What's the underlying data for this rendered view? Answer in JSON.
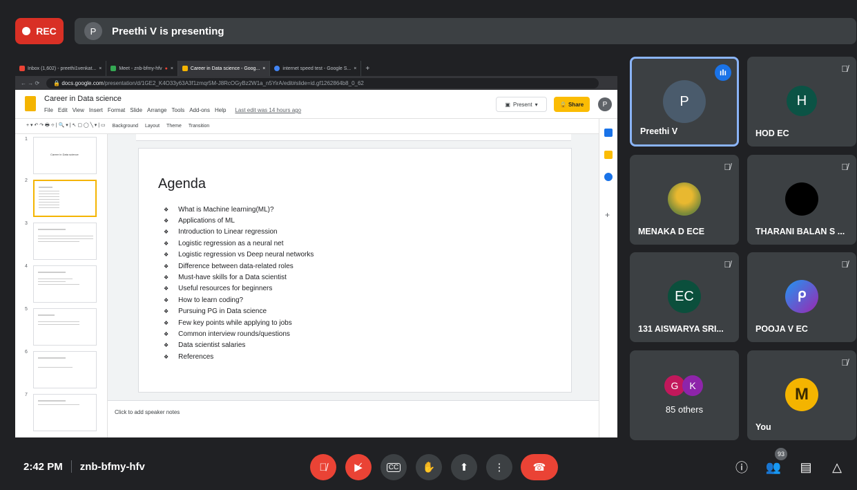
{
  "rec": {
    "label": "REC"
  },
  "presenter": {
    "initial": "P",
    "text": "Preethi V is presenting"
  },
  "browser": {
    "tabs": [
      {
        "label": "Inbox (1,602) - preethi1venkat...",
        "color": "#ea4335"
      },
      {
        "label": "Meet - znb-bfmy-hfv",
        "color": "#34a853"
      },
      {
        "label": "Career in Data science - Goog...",
        "color": "#f4b400"
      },
      {
        "label": "internet speed test - Google S...",
        "color": "#4285f4"
      }
    ],
    "url_domain": "docs.google.com",
    "url_path": "/presentation/d/1GE2_K4O33y63A3f1zmqr5M-J8RcOGyBz2W1a_n5YirA/edit#slide=id.gf1262864b8_0_62"
  },
  "slides_app": {
    "title": "Career in Data science",
    "menu": [
      "File",
      "Edit",
      "View",
      "Insert",
      "Format",
      "Slide",
      "Arrange",
      "Tools",
      "Add-ons",
      "Help"
    ],
    "last_edit": "Last edit was 14 hours ago",
    "present_label": "Present",
    "share_label": "Share",
    "user_initial": "P",
    "toolbar": [
      "Background",
      "Layout",
      "Theme",
      "Transition"
    ],
    "thumb_title": "Career in Data science",
    "thumb_numbers": [
      "1",
      "2",
      "3",
      "4",
      "5",
      "6",
      "7"
    ],
    "speaker_notes": "Click to add speaker notes",
    "slide": {
      "title": "Agenda",
      "items": [
        "What is Machine learning(ML)?",
        "Applications of ML",
        "Introduction to Linear regression",
        "Logistic regression as a neural net",
        "Logistic regression vs Deep neural networks",
        "Difference between data-related roles",
        "Must-have skills for a Data scientist",
        "Useful resources for beginners",
        "How to learn coding?",
        "Pursuing PG in Data science",
        "Few key points while applying to jobs",
        "Common interview rounds/questions",
        "Data scientist salaries",
        "References"
      ]
    }
  },
  "participants": [
    {
      "name": "Preethi V",
      "initial": "P",
      "color": "#4a5b6c",
      "speaking": true
    },
    {
      "name": "HOD EC",
      "initial": "H",
      "color": "#0b5345"
    },
    {
      "name": "MENAKA D ECE",
      "initial": "",
      "color": "#c9a227"
    },
    {
      "name": "THARANI BALAN S ...",
      "initial": "",
      "color": "#000000"
    },
    {
      "name": "131 AISWARYA SRI...",
      "initial": "EC",
      "color": "#0b4f3c"
    },
    {
      "name": "POOJA V EC",
      "initial": "",
      "color": "#7b2ff7"
    },
    {
      "name": "85 others",
      "initial": "",
      "color": ""
    },
    {
      "name": "You",
      "initial": "",
      "color": "#f4b400"
    }
  ],
  "others": {
    "a": "G",
    "b": "K",
    "a_color": "#c2185b",
    "b_color": "#8e24aa"
  },
  "footer": {
    "time": "2:42 PM",
    "meeting_code": "znb-bfmy-hfv",
    "people_count": "93"
  }
}
